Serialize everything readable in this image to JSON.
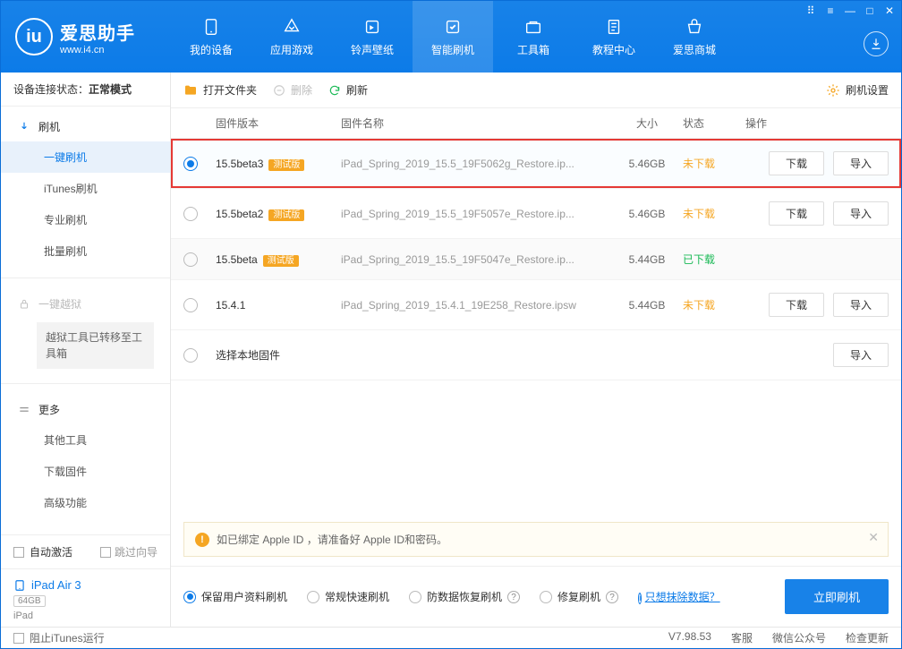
{
  "app": {
    "brand": "爱思助手",
    "site": "www.i4.cn"
  },
  "titlebar_icons": [
    "grid",
    "menu",
    "min",
    "max",
    "close"
  ],
  "nav": [
    {
      "label": "我的设备"
    },
    {
      "label": "应用游戏"
    },
    {
      "label": "铃声壁纸"
    },
    {
      "label": "智能刷机",
      "active": true
    },
    {
      "label": "工具箱"
    },
    {
      "label": "教程中心"
    },
    {
      "label": "爱思商城"
    }
  ],
  "sidebar": {
    "devstate_label": "设备连接状态：",
    "devstate_value": "正常模式",
    "groups": [
      {
        "title": "刷机",
        "items": [
          {
            "label": "一键刷机",
            "active": true
          },
          {
            "label": "iTunes刷机"
          },
          {
            "label": "专业刷机"
          },
          {
            "label": "批量刷机"
          }
        ]
      },
      {
        "title": "一键越狱",
        "locked": true,
        "notice": "越狱工具已转移至工具箱"
      },
      {
        "title": "更多",
        "items": [
          {
            "label": "其他工具"
          },
          {
            "label": "下载固件"
          },
          {
            "label": "高级功能"
          }
        ]
      }
    ],
    "auto_activate": "自动激活",
    "skip_guide": "跳过向导",
    "device": {
      "name": "iPad Air 3",
      "capacity": "64GB",
      "type": "iPad"
    }
  },
  "toolbar": {
    "open": "打开文件夹",
    "delete": "删除",
    "refresh": "刷新",
    "settings": "刷机设置"
  },
  "columns": {
    "version": "固件版本",
    "name": "固件名称",
    "size": "大小",
    "status": "状态",
    "ops": "操作"
  },
  "rows": [
    {
      "selected": true,
      "version": "15.5beta3",
      "beta": true,
      "name": "iPad_Spring_2019_15.5_19F5062g_Restore.ip...",
      "size": "5.46GB",
      "status": "未下载",
      "status_color": "orange",
      "download": true,
      "import": true,
      "highlight": true
    },
    {
      "version": "15.5beta2",
      "beta": true,
      "name": "iPad_Spring_2019_15.5_19F5057e_Restore.ip...",
      "size": "5.46GB",
      "status": "未下载",
      "status_color": "orange",
      "download": true,
      "import": true
    },
    {
      "version": "15.5beta",
      "beta": true,
      "name": "iPad_Spring_2019_15.5_19F5047e_Restore.ip...",
      "size": "5.44GB",
      "status": "已下载",
      "status_color": "green",
      "download": false,
      "import": false,
      "shaded": true
    },
    {
      "version": "15.4.1",
      "beta": false,
      "name": "iPad_Spring_2019_15.4.1_19E258_Restore.ipsw",
      "size": "5.44GB",
      "status": "未下载",
      "status_color": "orange",
      "download": true,
      "import": true
    },
    {
      "version": "选择本地固件",
      "local": true,
      "import": true
    }
  ],
  "buttons": {
    "download": "下载",
    "import": "导入"
  },
  "notice": "如已绑定 Apple ID ，请准备好 Apple ID和密码。",
  "flash_options": [
    {
      "label": "保留用户资料刷机",
      "on": true
    },
    {
      "label": "常规快速刷机"
    },
    {
      "label": "防数据恢复刷机",
      "help": true
    },
    {
      "label": "修复刷机",
      "help": true
    }
  ],
  "erase_link": "只想抹除数据？",
  "flash_button": "立即刷机",
  "statusbar": {
    "block_itunes": "阻止iTunes运行",
    "version_label": "V7.98.53",
    "links": [
      "客服",
      "微信公众号",
      "检查更新"
    ]
  },
  "beta_tag": "测试版"
}
